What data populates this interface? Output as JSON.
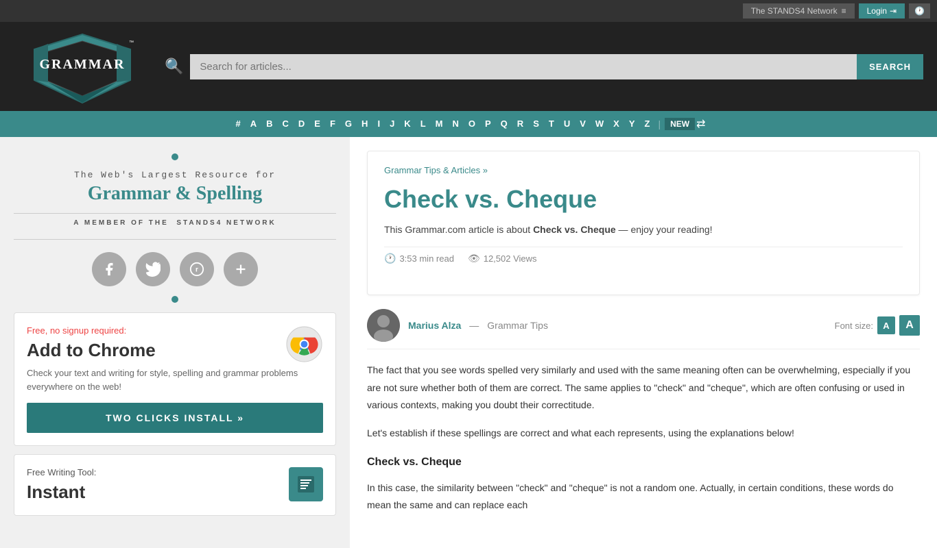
{
  "topbar": {
    "network_label": "The STANDS4 Network",
    "login_label": "Login",
    "history_icon": "🕐"
  },
  "header": {
    "search_placeholder": "Search for articles...",
    "search_button": "SEARCH"
  },
  "alphabet": {
    "letters": [
      "#",
      "A",
      "B",
      "C",
      "D",
      "E",
      "F",
      "G",
      "H",
      "I",
      "J",
      "K",
      "L",
      "M",
      "N",
      "O",
      "P",
      "Q",
      "R",
      "S",
      "T",
      "U",
      "V",
      "W",
      "X",
      "Y",
      "Z"
    ],
    "new_label": "NEW"
  },
  "sidebar": {
    "tagline": "The Web's Largest Resource for",
    "title": "Grammar & Spelling",
    "member_prefix": "A MEMBER OF THE",
    "member_name": "STANDS4 NETWORK",
    "free_tag": "Free, no signup required:",
    "chrome_heading": "Add to Chrome",
    "chrome_desc": "Check your text and writing for style, spelling and grammar problems everywhere on the web!",
    "install_btn": "TWO CLICKS INSTALL »",
    "free_tool_tag": "Free Writing Tool:",
    "instant_heading": "Instant"
  },
  "article": {
    "breadcrumb": "Grammar Tips & Articles »",
    "title": "Check vs. Cheque",
    "intro_text": "This Grammar.com article is about ",
    "intro_bold": "Check vs. Cheque",
    "intro_suffix": " — enjoy your reading!",
    "read_time": "3:53 min read",
    "views": "12,502 Views",
    "author_name": "Marius Alza",
    "author_separator": "—",
    "author_category": "Grammar Tips",
    "font_size_label": "Font size:",
    "font_small": "A",
    "font_large": "A",
    "body_p1": "The fact that you see words spelled very similarly and used with the same meaning often can be overwhelming, especially if you are not sure whether both of them are correct. The same applies to \"check\" and \"cheque\", which are often confusing or used in various contexts, making you doubt their correctitude.",
    "body_p2": "Let's establish if these spellings are correct and what each represents, using the explanations below!",
    "body_h3": "Check vs. Cheque",
    "body_p3": "In this case, the similarity between \"check\" and \"cheque\" is not a random one. Actually, in certain conditions, these words do mean the same and can replace each"
  }
}
